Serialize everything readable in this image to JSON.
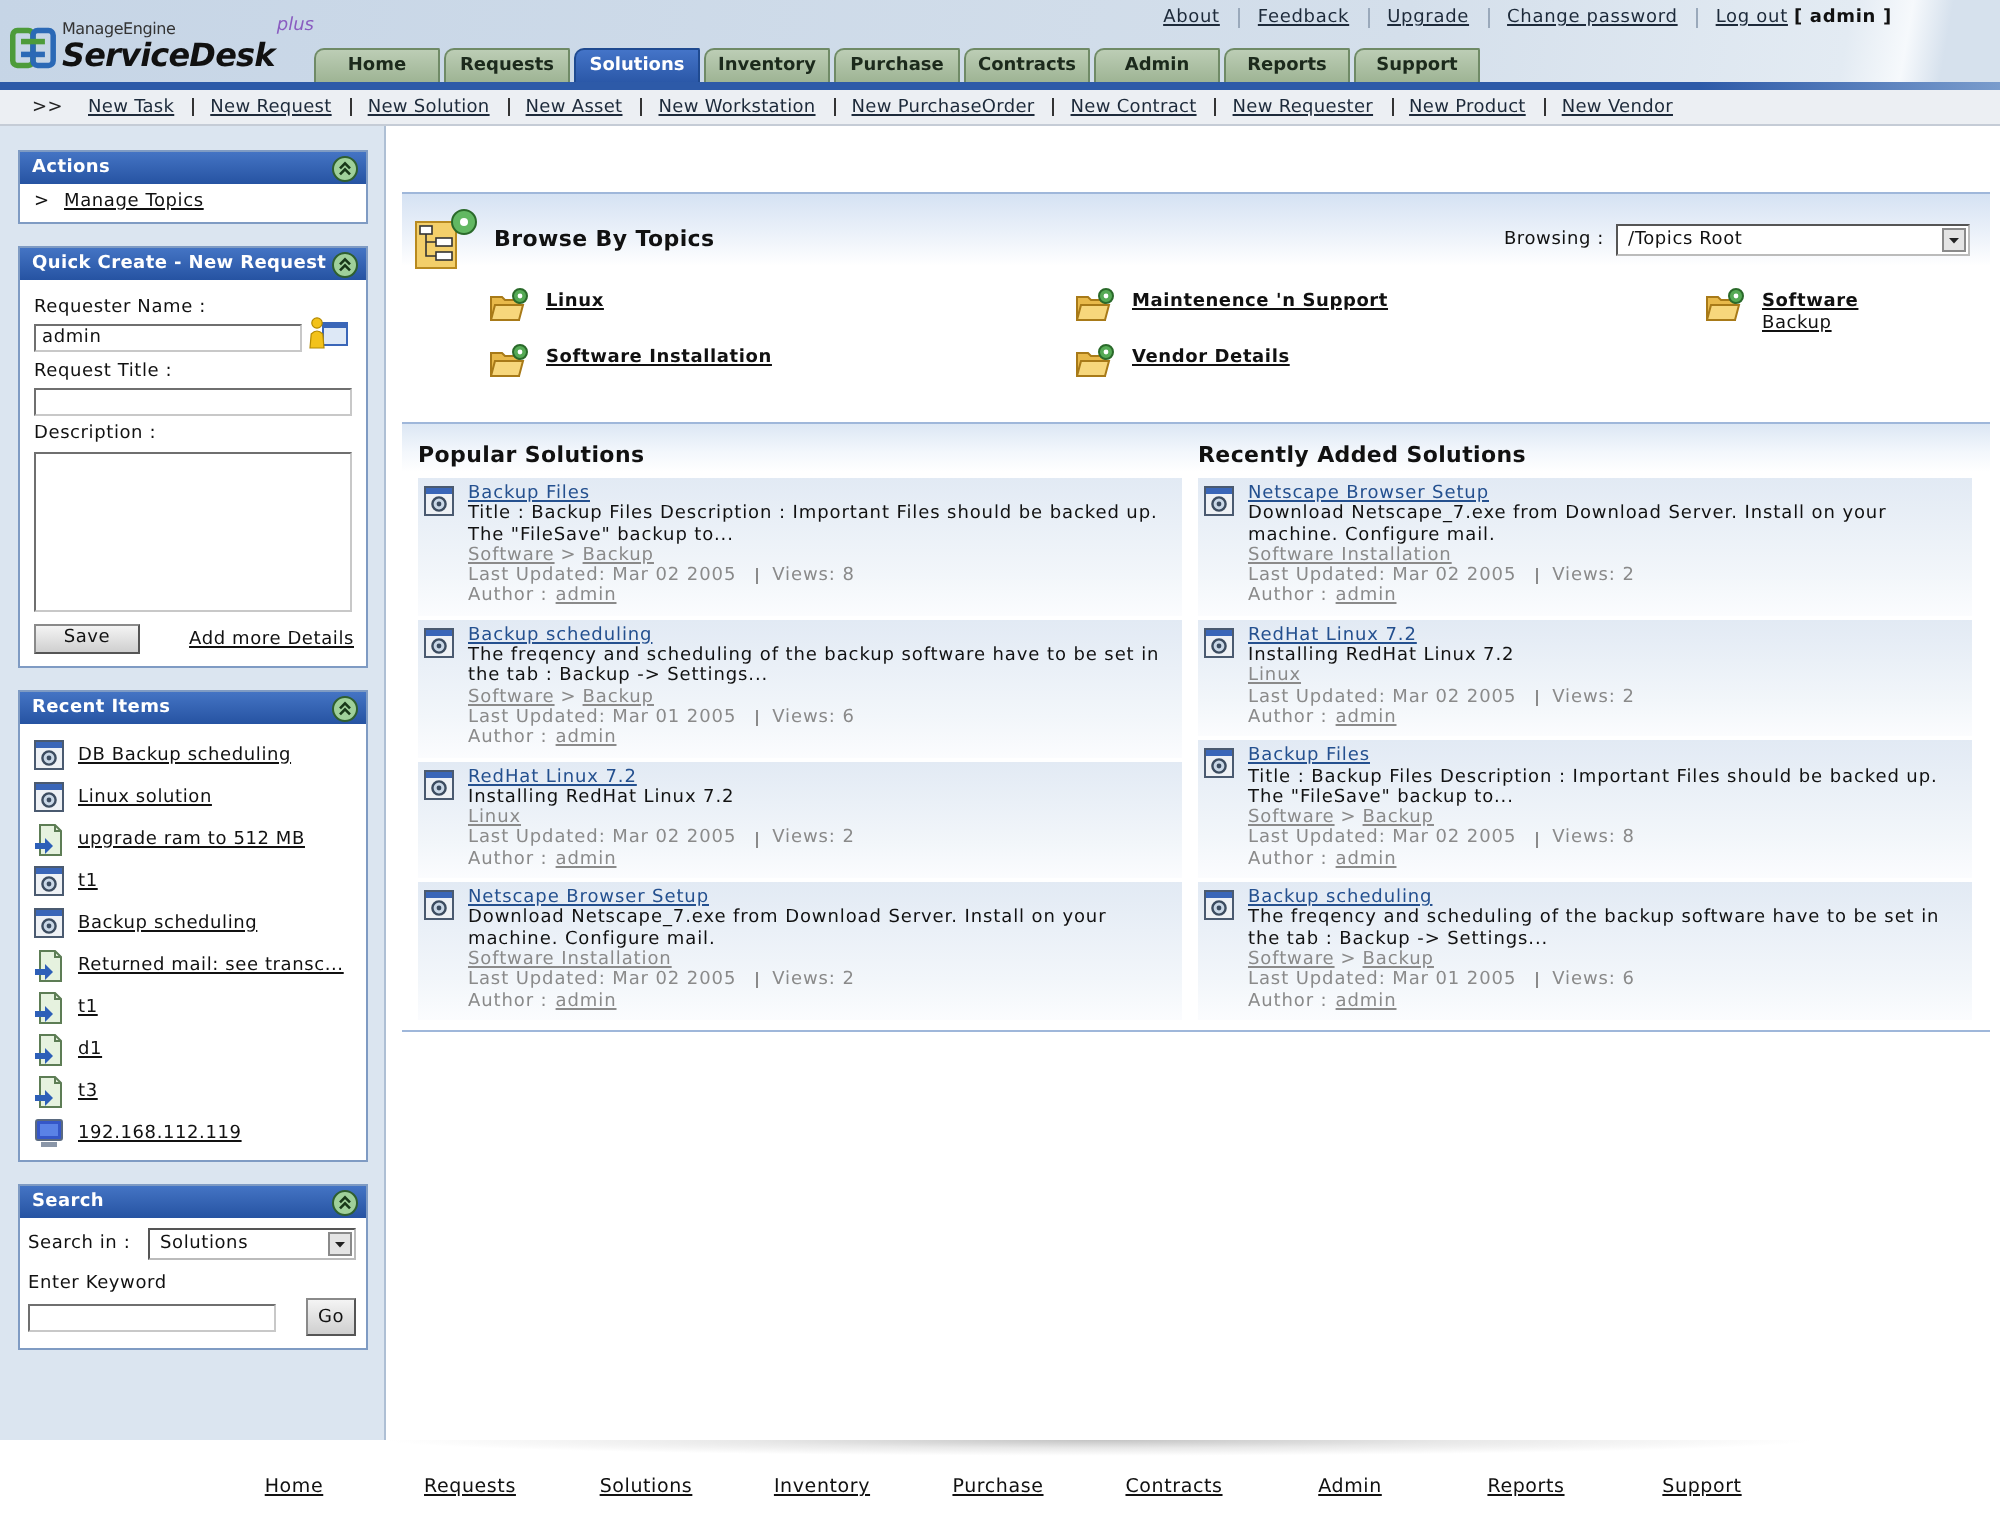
{
  "header": {
    "logo": {
      "vendor": "ManageEngine",
      "product": "ServiceDesk",
      "edition": "plus"
    },
    "top_links": [
      "About",
      "Feedback",
      "Upgrade",
      "Change password",
      "Log out"
    ],
    "user": "[ admin ]"
  },
  "tabs": [
    {
      "label": "Home",
      "selected": false
    },
    {
      "label": "Requests",
      "selected": false
    },
    {
      "label": "Solutions",
      "selected": true
    },
    {
      "label": "Inventory",
      "selected": false
    },
    {
      "label": "Purchase",
      "selected": false
    },
    {
      "label": "Contracts",
      "selected": false
    },
    {
      "label": "Admin",
      "selected": false
    },
    {
      "label": "Reports",
      "selected": false
    },
    {
      "label": "Support",
      "selected": false
    }
  ],
  "quick_links": {
    "prefix": ">>",
    "items": [
      "New Task",
      "New Request",
      "New Solution",
      "New Asset",
      "New Workstation",
      "New PurchaseOrder",
      "New Contract",
      "New Requester",
      "New Product",
      "New Vendor"
    ]
  },
  "sidebar": {
    "actions": {
      "title": "Actions",
      "items": [
        {
          "marker": ">",
          "label": "Manage Topics"
        }
      ]
    },
    "quick_create": {
      "title": "Quick Create - New Request",
      "requester_label": "Requester Name :",
      "requester_value": "admin",
      "title_label": "Request Title :",
      "description_label": "Description :",
      "save": "Save",
      "more_details": "Add more Details"
    },
    "recent_items": {
      "title": "Recent Items",
      "items": [
        {
          "kind": "solution",
          "label": "DB Backup scheduling"
        },
        {
          "kind": "solution",
          "label": "Linux solution"
        },
        {
          "kind": "request",
          "label": "upgrade ram to 512 MB"
        },
        {
          "kind": "solution",
          "label": "t1"
        },
        {
          "kind": "solution",
          "label": "Backup scheduling"
        },
        {
          "kind": "request",
          "label": "Returned mail: see transc..."
        },
        {
          "kind": "request",
          "label": "t1"
        },
        {
          "kind": "request",
          "label": "d1"
        },
        {
          "kind": "request",
          "label": "t3"
        },
        {
          "kind": "workstation",
          "label": "192.168.112.119"
        }
      ]
    },
    "search": {
      "title": "Search",
      "search_in_label": "Search in :",
      "search_in_value": "Solutions",
      "keyword_label": "Enter Keyword",
      "go": "Go"
    }
  },
  "browse": {
    "title": "Browse By Topics",
    "browsing_label": "Browsing :",
    "browsing_value": "/Topics Root",
    "topics": [
      {
        "label": "Linux"
      },
      {
        "label": "Maintenence 'n Support"
      },
      {
        "label": "Software",
        "children": [
          {
            "label": "Backup"
          }
        ]
      },
      {
        "label": "Software Installation"
      },
      {
        "label": "Vendor Details"
      }
    ]
  },
  "solutions": [
    {
      "title": "Popular Solutions",
      "items": [
        {
          "title": "Backup Files",
          "description": "Title : Backup Files Description : Important Files should be backed up. The \"FileSave\" backup to...",
          "path": [
            "Software",
            "Backup"
          ],
          "path_separator": ">",
          "last_updated": "Last Updated: Mar 02 2005",
          "views": "Views: 8",
          "author_label": "Author :",
          "author": "admin"
        },
        {
          "title": "Backup scheduling",
          "description": "The freqency and scheduling of the backup software have to be set in the tab : Backup -> Settings...",
          "path": [
            "Software",
            "Backup"
          ],
          "path_separator": ">",
          "last_updated": "Last Updated: Mar 01 2005",
          "views": "Views: 6",
          "author_label": "Author :",
          "author": "admin"
        },
        {
          "title": "RedHat Linux 7.2",
          "description": "Installing RedHat Linux 7.2",
          "path": [
            "Linux"
          ],
          "last_updated": "Last Updated: Mar 02 2005",
          "views": "Views: 2",
          "author_label": "Author :",
          "author": "admin"
        },
        {
          "title": "Netscape Browser Setup",
          "description": "Download Netscape_7.exe from Download Server. Install on your machine. Configure mail.",
          "path": [
            "Software Installation"
          ],
          "last_updated": "Last Updated: Mar 02 2005",
          "views": "Views: 2",
          "author_label": "Author :",
          "author": "admin"
        }
      ]
    },
    {
      "title": "Recently Added Solutions",
      "items": [
        {
          "title": "Netscape Browser Setup",
          "description": "Download Netscape_7.exe from Download Server. Install on your machine. Configure mail.",
          "path": [
            "Software Installation"
          ],
          "last_updated": "Last Updated: Mar 02 2005",
          "views": "Views: 2",
          "author_label": "Author :",
          "author": "admin"
        },
        {
          "title": "RedHat Linux 7.2",
          "description": "Installing RedHat Linux 7.2",
          "path": [
            "Linux"
          ],
          "last_updated": "Last Updated: Mar 02 2005",
          "views": "Views: 2",
          "author_label": "Author :",
          "author": "admin"
        },
        {
          "title": "Backup Files",
          "description": "Title : Backup Files Description : Important Files should be backed up. The \"FileSave\" backup to...",
          "path": [
            "Software",
            "Backup"
          ],
          "path_separator": ">",
          "last_updated": "Last Updated: Mar 02 2005",
          "views": "Views: 8",
          "author_label": "Author :",
          "author": "admin"
        },
        {
          "title": "Backup scheduling",
          "description": "The freqency and scheduling of the backup software have to be set in the tab : Backup -> Settings...",
          "path": [
            "Software",
            "Backup"
          ],
          "path_separator": ">",
          "last_updated": "Last Updated: Mar 01 2005",
          "views": "Views: 6",
          "author_label": "Author :",
          "author": "admin"
        }
      ]
    }
  ],
  "footer_links": [
    "Home",
    "Requests",
    "Solutions",
    "Inventory",
    "Purchase",
    "Contracts",
    "Admin",
    "Reports",
    "Support"
  ]
}
